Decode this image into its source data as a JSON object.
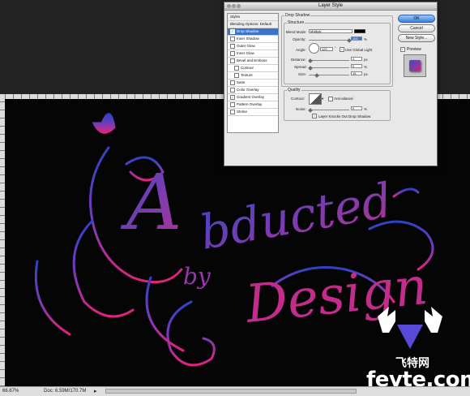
{
  "dialog": {
    "title": "Layer Style",
    "styles_list": [
      {
        "label": "Styles",
        "header": true
      },
      {
        "label": "Blending Options: Default",
        "header": true
      },
      {
        "label": "Drop Shadow",
        "checked": true,
        "selected": true
      },
      {
        "label": "Inner Shadow",
        "checked": false
      },
      {
        "label": "Outer Glow",
        "checked": false
      },
      {
        "label": "Inner Glow",
        "checked": false
      },
      {
        "label": "Bevel and Emboss",
        "checked": false
      },
      {
        "label": "Contour",
        "checked": false,
        "indent": true
      },
      {
        "label": "Texture",
        "checked": false,
        "indent": true
      },
      {
        "label": "Satin",
        "checked": false
      },
      {
        "label": "Color Overlay",
        "checked": false
      },
      {
        "label": "Gradient Overlay",
        "checked": true
      },
      {
        "label": "Pattern Overlay",
        "checked": false
      },
      {
        "label": "Stroke",
        "checked": false
      }
    ],
    "drop_shadow": {
      "group_title": "Drop Shadow",
      "structure_title": "Structure",
      "blend_mode_label": "Blend Mode:",
      "blend_mode_value": "Multiply",
      "opacity_label": "Opacity:",
      "opacity_value": "100",
      "angle_label": "Angle:",
      "angle_value": "120",
      "global_light_label": "Use Global Light",
      "distance_label": "Distance:",
      "distance_value": "1",
      "spread_label": "Spread:",
      "spread_value": "0",
      "size_label": "Size:",
      "size_value": "16",
      "percent_unit": "%",
      "px_unit": "px",
      "degree_unit": "°",
      "quality_title": "Quality",
      "contour_label": "Contour:",
      "anti_aliased_label": "Anti-aliased",
      "noise_label": "Noise:",
      "noise_value": "0",
      "knocks_out_label": "Layer Knocks Out Drop Shadow",
      "shadow_color": "#000000"
    },
    "buttons": {
      "ok": "OK",
      "cancel": "Cancel",
      "new_style": "New Style..."
    },
    "preview_label": "Preview"
  },
  "status": {
    "zoom": "66.67%",
    "doc": "Doc: 6.59M/170.7M"
  },
  "watermark": {
    "cn": "飞特网",
    "url": "fevte.com"
  },
  "colors": {
    "accent_blue": "#3d73c6",
    "text_gradient_top": "#3f47c8",
    "text_gradient_bottom": "#e0247a"
  }
}
